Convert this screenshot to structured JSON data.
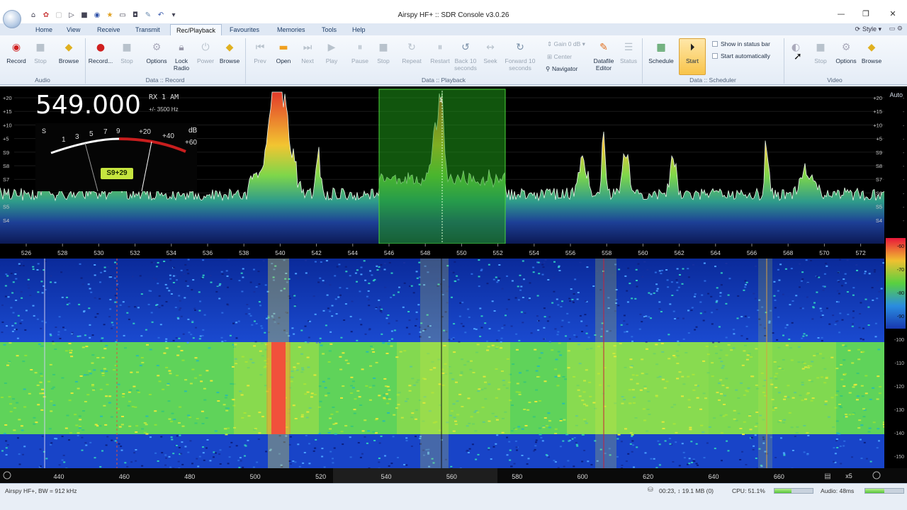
{
  "window": {
    "title": "Airspy HF+ :: SDR Console v3.0.26",
    "minimize": "—",
    "maximize": "❐",
    "close": "✕"
  },
  "tabs": [
    "Home",
    "View",
    "Receive",
    "Transmit",
    "Rec/Playback",
    "Favourites",
    "Memories",
    "Tools",
    "Help"
  ],
  "active_tab": "Rec/Playback",
  "style_menu": "Style",
  "ribbon": {
    "audio": {
      "group": "Audio",
      "record": "Record",
      "stop": "Stop",
      "browse": "Browse"
    },
    "data_record": {
      "group": "Data :: Record",
      "record": "Record...",
      "stop": "Stop",
      "options": "Options",
      "lock_radio": "Lock\nRadio",
      "power": "Power",
      "browse": "Browse"
    },
    "data_playback": {
      "group": "Data :: Playback",
      "prev": "Prev",
      "open": "Open",
      "next": "Next",
      "play": "Play",
      "pause": "Pause",
      "stop": "Stop",
      "repeat": "Repeat",
      "restart": "Restart",
      "back10": "Back 10\nseconds",
      "seek": "Seek",
      "fwd10": "Forward 10\nseconds",
      "gain": "Gain 0 dB",
      "center": "Center",
      "navigator": "Navigator",
      "datafile_editor": "Datafile\nEditor",
      "status": "Status"
    },
    "scheduler": {
      "group": "Data :: Scheduler",
      "schedule": "Schedule",
      "start": "Start",
      "show_status": "Show in status bar",
      "start_auto": "Start automatically"
    },
    "video": {
      "group": "Video",
      "stop": "Stop",
      "options": "Options",
      "browse": "Browse"
    }
  },
  "spectrum": {
    "frequency": "549.000",
    "rx": "RX 1   AM",
    "bandwidth": "+/- 3500 Hz",
    "signal": "S9+29",
    "auto": "Auto",
    "meter_scale": [
      "S",
      "1",
      "3",
      "5",
      "7",
      "9",
      "+20",
      "+40",
      "+60",
      "dB"
    ],
    "db_labels_left": [
      "+20",
      "+15",
      "+10",
      "+5",
      "S9",
      "S8",
      "S7",
      "S6",
      "S5",
      "S4"
    ],
    "db_labels_right": [
      "+20",
      "+15",
      "+10",
      "+5",
      "S9",
      "S8",
      "S7",
      "S6",
      "S5",
      "S4"
    ],
    "freq_ticks": [
      "526",
      "528",
      "530",
      "532",
      "534",
      "536",
      "538",
      "540",
      "542",
      "544",
      "546",
      "548",
      "550",
      "552",
      "554",
      "556",
      "558",
      "560",
      "562",
      "564",
      "566",
      "568",
      "570",
      "572"
    ]
  },
  "waterfall": {
    "axis_ticks": [
      "440",
      "460",
      "480",
      "500",
      "520",
      "540",
      "560",
      "580",
      "600",
      "620",
      "640",
      "660"
    ],
    "zoom": "x5",
    "colorbar_labels": [
      "-60",
      "-70",
      "-80",
      "-90",
      "-100",
      "-110",
      "-120",
      "-130",
      "-140",
      "-150"
    ]
  },
  "status": {
    "left": "Airspy HF+, BW = 912 kHz",
    "record": "00:23, ↕ 19.1 MB (0)",
    "cpu": "CPU: 51.1%",
    "audio": "Audio: 48ms",
    "cpu_level": 0.45,
    "audio_level": 0.5
  },
  "colors": {
    "ribbon_bg": "#eef3fa",
    "spectrum_bg": "#000000",
    "passband": "#2aa11a",
    "signal_badge": "#c6e53f"
  }
}
